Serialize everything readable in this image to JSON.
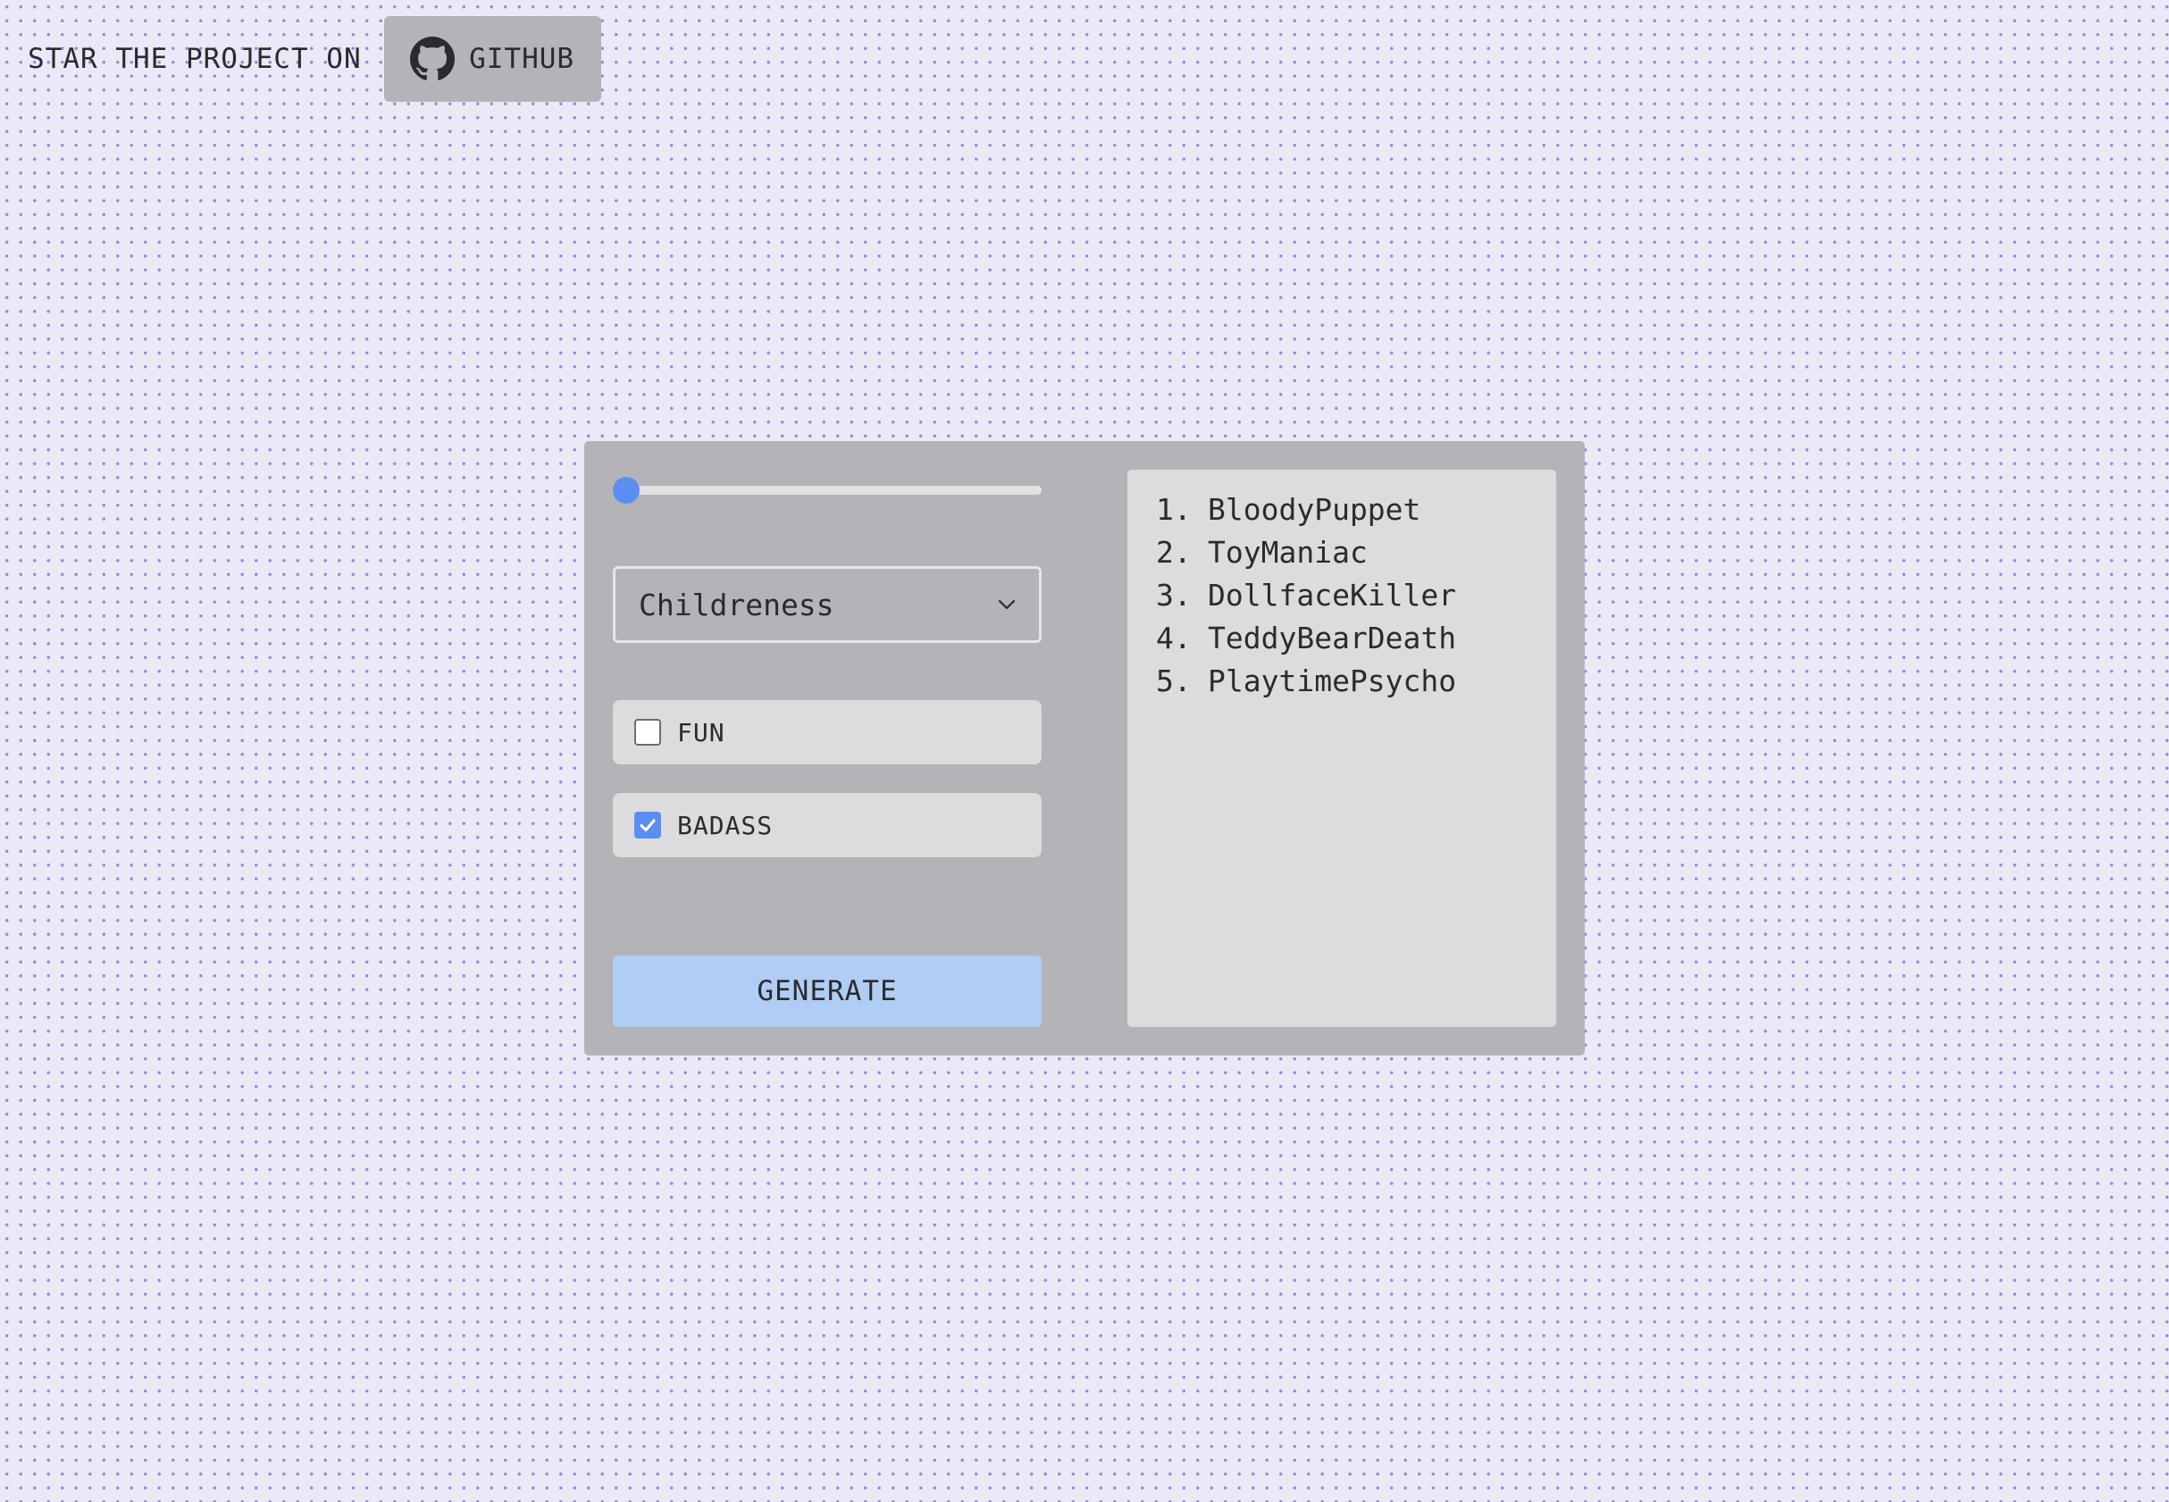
{
  "header": {
    "star_text": "STAR THE PROJECT ON",
    "github_label": "GITHUB",
    "github_icon": "github-icon"
  },
  "form": {
    "slider": {
      "value_fraction": 0.0
    },
    "select": {
      "value": "Childreness",
      "icon": "chevron-down-icon"
    },
    "options": [
      {
        "label": "FUN",
        "checked": false
      },
      {
        "label": "BADASS",
        "checked": true
      }
    ],
    "generate_label": "GENERATE"
  },
  "results": {
    "items": [
      {
        "num": "1.",
        "name": "BloodyPuppet"
      },
      {
        "num": "2.",
        "name": "ToyManiac"
      },
      {
        "num": "3.",
        "name": "DollfaceKiller"
      },
      {
        "num": "4.",
        "name": "TeddyBearDeath"
      },
      {
        "num": "5.",
        "name": "PlaytimePsycho"
      }
    ]
  },
  "colors": {
    "accent": "#5b8ef0",
    "button": "#afcdf5",
    "card": "#b4b3b8",
    "panel": "#dcdcde",
    "background": "#ebe9f6",
    "dots": "#8f8ed6"
  }
}
